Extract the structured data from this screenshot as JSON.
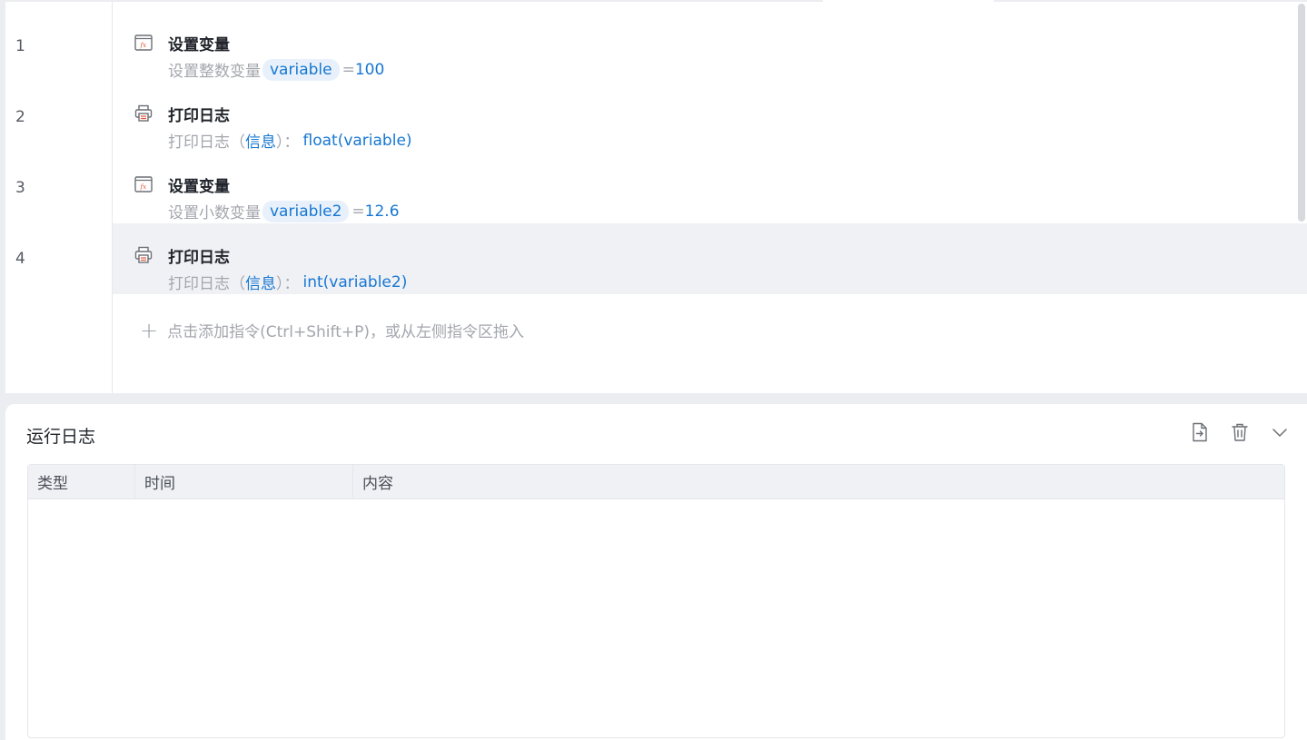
{
  "steps": [
    {
      "line": "1",
      "icon": "function-icon",
      "title": "设置变量",
      "desc_prefix": "设置整数变量",
      "var_name": "variable",
      "assign": "=",
      "value": "100"
    },
    {
      "line": "2",
      "icon": "printer-icon",
      "title": "打印日志",
      "desc_prefix": "打印日志（",
      "level": "信息",
      "desc_mid": "）：",
      "expr": "float(variable)"
    },
    {
      "line": "3",
      "icon": "function-icon",
      "title": "设置变量",
      "desc_prefix": "设置小数变量",
      "var_name": "variable2",
      "assign": "=",
      "value": "12.6"
    },
    {
      "line": "4",
      "icon": "printer-icon",
      "title": "打印日志",
      "desc_prefix": "打印日志（",
      "level": "信息",
      "desc_mid": "）：",
      "expr": "int(variable2)"
    }
  ],
  "add_hint": "点击添加指令(Ctrl+Shift+P)，或从左侧指令区拖入",
  "log": {
    "title": "运行日志",
    "columns": [
      "类型",
      "时间",
      "内容"
    ],
    "rows": []
  },
  "colors": {
    "accent": "#1677d2",
    "selected_row": "#f0f1f5",
    "muted_text": "#a3a6ad"
  }
}
